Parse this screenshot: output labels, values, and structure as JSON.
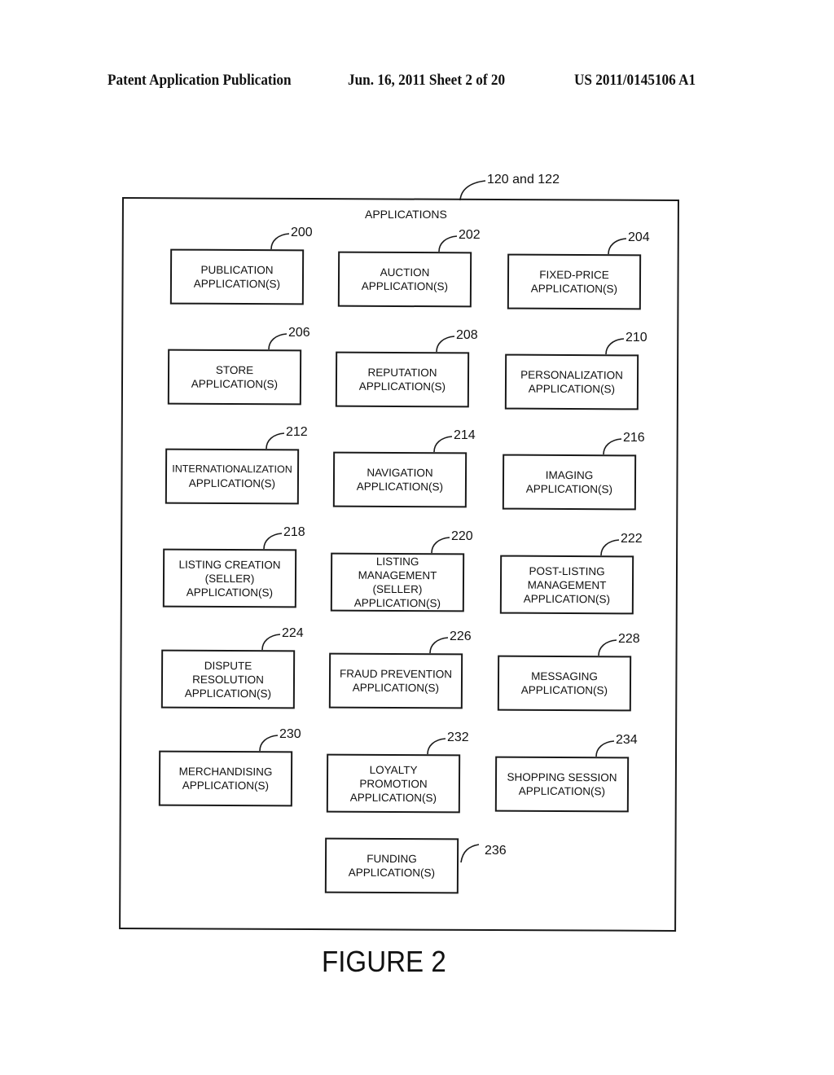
{
  "header": {
    "left": "Patent Application Publication",
    "middle": "Jun. 16, 2011  Sheet 2 of 20",
    "right": "US 2011/0145106 A1"
  },
  "diagram": {
    "container_ref": "120 and 122",
    "container_title": "APPLICATIONS",
    "boxes": [
      {
        "ref": "200",
        "lines": [
          "PUBLICATION",
          "APPLICATION(S)"
        ]
      },
      {
        "ref": "202",
        "lines": [
          "AUCTION",
          "APPLICATION(S)"
        ]
      },
      {
        "ref": "204",
        "lines": [
          "FIXED-PRICE",
          "APPLICATION(S)"
        ]
      },
      {
        "ref": "206",
        "lines": [
          "STORE",
          "APPLICATION(S)"
        ]
      },
      {
        "ref": "208",
        "lines": [
          "REPUTATION",
          "APPLICATION(S)"
        ]
      },
      {
        "ref": "210",
        "lines": [
          "PERSONALIZATION",
          "APPLICATION(S)"
        ]
      },
      {
        "ref": "212",
        "lines": [
          "INTERNATIONALIZATION",
          "APPLICATION(S)"
        ]
      },
      {
        "ref": "214",
        "lines": [
          "NAVIGATION",
          "APPLICATION(S)"
        ]
      },
      {
        "ref": "216",
        "lines": [
          "IMAGING",
          "APPLICATION(S)"
        ]
      },
      {
        "ref": "218",
        "lines": [
          "LISTING CREATION",
          "(SELLER)",
          "APPLICATION(S)"
        ]
      },
      {
        "ref": "220",
        "lines": [
          "LISTING",
          "MANAGEMENT",
          "(SELLER)",
          "APPLICATION(S)"
        ]
      },
      {
        "ref": "222",
        "lines": [
          "POST-LISTING",
          "MANAGEMENT",
          "APPLICATION(S)"
        ]
      },
      {
        "ref": "224",
        "lines": [
          "DISPUTE",
          "RESOLUTION",
          "APPLICATION(S)"
        ]
      },
      {
        "ref": "226",
        "lines": [
          "FRAUD PREVENTION",
          "APPLICATION(S)"
        ]
      },
      {
        "ref": "228",
        "lines": [
          "MESSAGING",
          "APPLICATION(S)"
        ]
      },
      {
        "ref": "230",
        "lines": [
          "MERCHANDISING",
          "APPLICATION(S)"
        ]
      },
      {
        "ref": "232",
        "lines": [
          "LOYALTY",
          "PROMOTION",
          "APPLICATION(S)"
        ]
      },
      {
        "ref": "234",
        "lines": [
          "SHOPPING SESSION",
          "APPLICATION(S)"
        ]
      },
      {
        "ref": "236",
        "lines": [
          "FUNDING",
          "APPLICATION(S)"
        ]
      }
    ]
  },
  "figure_label": "FIGURE 2"
}
